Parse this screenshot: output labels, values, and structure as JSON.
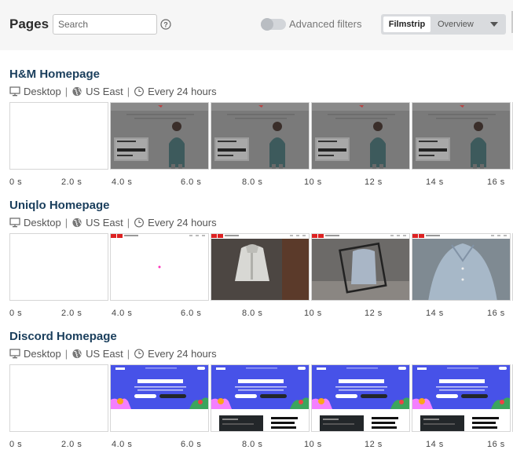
{
  "header": {
    "title": "Pages",
    "search_placeholder": "Search",
    "advanced_filters_label": "Advanced filters",
    "view_modes": [
      "Filmstrip",
      "Overview"
    ],
    "active_view": "Filmstrip"
  },
  "sections": [
    {
      "title": "H&M Homepage",
      "device": "Desktop",
      "region": "US East",
      "schedule": "Every 24 hours",
      "thumb_kind": "hm"
    },
    {
      "title": "Uniqlo Homepage",
      "device": "Desktop",
      "region": "US East",
      "schedule": "Every 24 hours",
      "thumb_kind": "uniqlo"
    },
    {
      "title": "Discord Homepage",
      "device": "Desktop",
      "region": "US East",
      "schedule": "Every 24 hours",
      "thumb_kind": "discord"
    }
  ],
  "timeline_labels": [
    "0 s",
    "2.0 s",
    "4.0 s",
    "6.0 s",
    "8.0 s",
    "10 s",
    "12 s",
    "14 s",
    "16 s"
  ],
  "colors": {
    "title": "#1a3e5c",
    "discord_blurple": "#4752e8"
  }
}
